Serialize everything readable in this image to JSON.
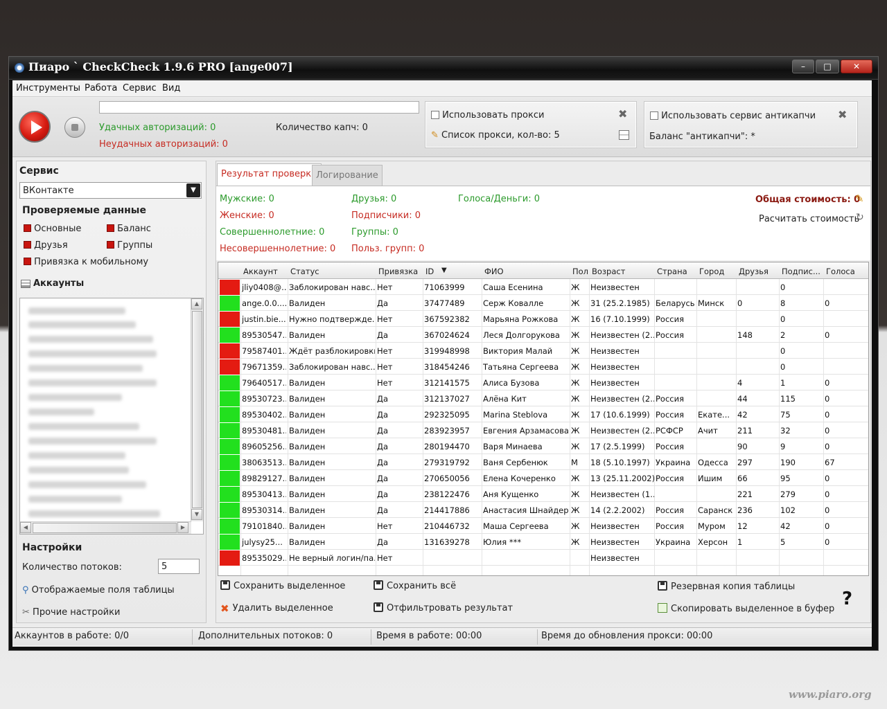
{
  "window": {
    "title": "Пиаро ` CheckCheck 1.9.6 PRO [ange007]",
    "min": "–",
    "max": "□",
    "close": "✕"
  },
  "menu": [
    "Инструменты",
    "Работа",
    "Сервис",
    "Вид"
  ],
  "toolbar": {
    "progress_value": "",
    "success_auth": "Удачных авторизаций: 0",
    "fail_auth": "Неудачных авторизаций: 0",
    "captcha_count": "Количество капч: 0",
    "use_proxy": "Использовать прокси",
    "proxy_list": "Список прокси, кол-во: 5",
    "use_anticaptcha": "Использовать сервис антикапчи",
    "anticaptcha_balance": "Баланс \"антикапчи\": *"
  },
  "left": {
    "service_title": "Сервис",
    "service_value": "ВКонтакте",
    "checked_title": "Проверяемые данные",
    "checks": [
      "Основные",
      "Баланс",
      "Друзья",
      "Группы",
      "Привязка к мобильному"
    ],
    "accounts_title": "Аккаунты",
    "settings_title": "Настройки",
    "threads_label": "Количество потоков:",
    "threads_value": "5",
    "fields_link": "Отображаемые поля таблицы",
    "other_link": "Прочие настройки"
  },
  "tabs": [
    "Результат проверки",
    "Логирование"
  ],
  "summary": {
    "male": "Мужские: 0",
    "female": "Женские: 0",
    "adult": "Совершеннолетние: 0",
    "minor": "Несовершеннолетние: 0",
    "friends": "Друзья: 0",
    "subscribers": "Подписчики: 0",
    "groups": "Группы: 0",
    "group_users": "Польз. групп: 0",
    "votes": "Голоса/Деньги: 0",
    "total_cost": "Общая стоимость: 0",
    "calc_cost": "Расчитать стоимость"
  },
  "table": {
    "headers": [
      "Аккаунт",
      "Статус",
      "Привязка",
      "ID",
      "ФИО",
      "Пол",
      "Возраст",
      "Страна",
      "Город",
      "Друзья",
      "Подпис...",
      "Голоса"
    ],
    "sort_indicator": "▼",
    "rows": [
      {
        "mark": "#e41b12",
        "c": [
          "jliy0408@...",
          "Заблокирован навс...",
          "Нет",
          "71063999",
          "Саша Есенина",
          "Ж",
          "Неизвестен",
          "",
          "",
          "",
          "0",
          ""
        ]
      },
      {
        "mark": "#22e01e",
        "c": [
          "ange.0.0....",
          "Валиден",
          "Да",
          "37477489",
          "Серж Ковалле",
          "Ж",
          "31 (25.2.1985)",
          "Беларусь",
          "Минск",
          "0",
          "8",
          "0"
        ]
      },
      {
        "mark": "#e41b12",
        "c": [
          "justin.bie...",
          "Нужно подтвержде...",
          "Нет",
          "367592382",
          "Марьяна Рожкова",
          "Ж",
          "16 (7.10.1999)",
          "Россия",
          "",
          "",
          "0",
          ""
        ]
      },
      {
        "mark": "#22e01e",
        "c": [
          "89530547...",
          "Валиден",
          "Да",
          "367024624",
          "Леся Долгорукова",
          "Ж",
          "Неизвестен (2...",
          "Россия",
          "",
          "148",
          "2",
          "0"
        ]
      },
      {
        "mark": "#e41b12",
        "c": [
          "79587401...",
          "Ждёт разблокировки",
          "Нет",
          "319948998",
          "Виктория Малай",
          "Ж",
          "Неизвестен",
          "",
          "",
          "",
          "0",
          ""
        ]
      },
      {
        "mark": "#e41b12",
        "c": [
          "79671359...",
          "Заблокирован навс...",
          "Нет",
          "318454246",
          "Татьяна Сергеева",
          "Ж",
          "Неизвестен",
          "",
          "",
          "",
          "0",
          ""
        ]
      },
      {
        "mark": "#22e01e",
        "c": [
          "79640517...",
          "Валиден",
          "Нет",
          "312141575",
          "Алиса Бузова",
          "Ж",
          "Неизвестен",
          "",
          "",
          "4",
          "1",
          "0"
        ]
      },
      {
        "mark": "#22e01e",
        "c": [
          "89530723...",
          "Валиден",
          "Да",
          "312137027",
          "Алёна Кит",
          "Ж",
          "Неизвестен (2...",
          "Россия",
          "",
          "44",
          "115",
          "0"
        ]
      },
      {
        "mark": "#22e01e",
        "c": [
          "89530402...",
          "Валиден",
          "Да",
          "292325095",
          "Marina Steblova",
          "Ж",
          "17 (10.6.1999)",
          "Россия",
          "Екате...",
          "42",
          "75",
          "0"
        ]
      },
      {
        "mark": "#22e01e",
        "c": [
          "89530481...",
          "Валиден",
          "Да",
          "283923957",
          "Евгения Арзамасова",
          "Ж",
          "Неизвестен (2...",
          "РСФСР",
          "Ачит",
          "211",
          "32",
          "0"
        ]
      },
      {
        "mark": "#22e01e",
        "c": [
          "89605256...",
          "Валиден",
          "Да",
          "280194470",
          "Варя Минаева",
          "Ж",
          "17 (2.5.1999)",
          "Россия",
          "",
          "90",
          "9",
          "0"
        ]
      },
      {
        "mark": "#22e01e",
        "c": [
          "38063513...",
          "Валиден",
          "Да",
          "279319792",
          "Ваня Сербенюк",
          "М",
          "18 (5.10.1997)",
          "Украина",
          "Одесса",
          "297",
          "190",
          "67"
        ]
      },
      {
        "mark": "#22e01e",
        "c": [
          "89829127...",
          "Валиден",
          "Да",
          "270650056",
          "Елена Кочеренко",
          "Ж",
          "13 (25.11.2002)",
          "Россия",
          "Ишим",
          "66",
          "95",
          "0"
        ]
      },
      {
        "mark": "#22e01e",
        "c": [
          "89530413...",
          "Валиден",
          "Да",
          "238122476",
          "Аня Кущенко",
          "Ж",
          "Неизвестен (1...",
          "",
          "",
          "221",
          "279",
          "0"
        ]
      },
      {
        "mark": "#22e01e",
        "c": [
          "89530314...",
          "Валиден",
          "Да",
          "214417886",
          "Анастасия Шнайдер",
          "Ж",
          "14 (2.2.2002)",
          "Россия",
          "Саранск",
          "236",
          "102",
          "0"
        ]
      },
      {
        "mark": "#22e01e",
        "c": [
          "79101840...",
          "Валиден",
          "Нет",
          "210446732",
          "Маша Сергеева",
          "Ж",
          "Неизвестен",
          "Россия",
          "Муром",
          "12",
          "42",
          "0"
        ]
      },
      {
        "mark": "#22e01e",
        "c": [
          "julysy25...",
          "Валиден",
          "Да",
          "131639278",
          "Юлия ***",
          "Ж",
          "Неизвестен",
          "Украина",
          "Херсон",
          "1",
          "5",
          "0"
        ]
      },
      {
        "mark": "#e41b12",
        "c": [
          "89535029...",
          "Не верный логин/па...",
          "Нет",
          "",
          "",
          "",
          "Неизвестен",
          "",
          "",
          "",
          "",
          ""
        ]
      }
    ]
  },
  "actions": {
    "save_selected": "Сохранить выделенное",
    "save_all": "Сохранить всё",
    "backup": "Резервная копия таблицы",
    "delete_selected": "Удалить выделенное",
    "filter": "Отфильтровать результат",
    "copy_selected": "Скопировать выделенное в буфер",
    "help": "?"
  },
  "status": {
    "accounts": "Аккаунтов в работе: 0/0",
    "extra_threads": "Дополнительных потоков: 0",
    "work_time": "Время в работе: 00:00",
    "proxy_update": "Время до обновления прокси: 00:00"
  },
  "watermark": "www.piaro.org",
  "icons": [
    "play-icon",
    "stop-icon",
    "tools-icon",
    "list-icon",
    "pencil-icon",
    "refresh-icon",
    "save-icon",
    "delete-icon",
    "copy-icon",
    "search-icon",
    "wrench-icon",
    "accounts-icon"
  ]
}
